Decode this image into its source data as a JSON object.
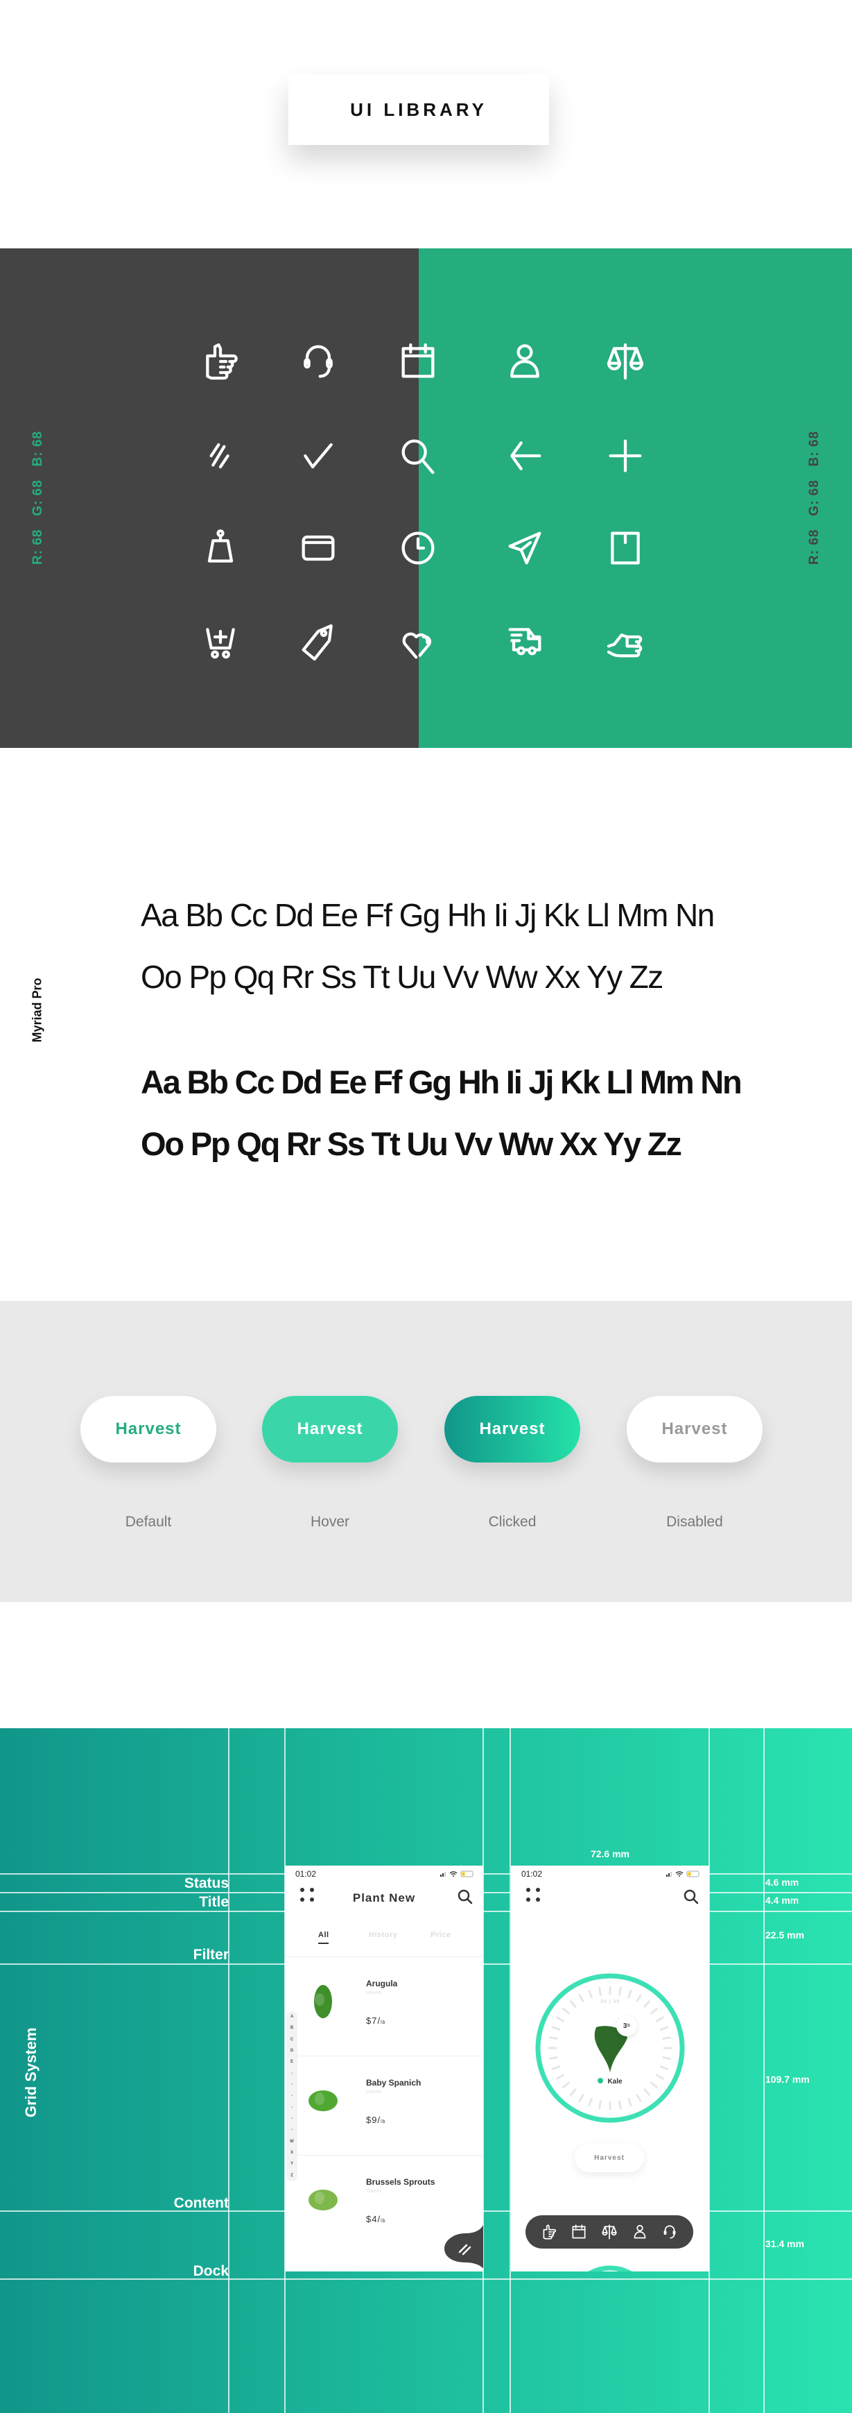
{
  "header": {
    "title": "UI LIBRARY"
  },
  "icons": {
    "colors": {
      "dark": "#444444",
      "green": "#25ad7e"
    },
    "left_label": "R: 68   G: 68   B: 68",
    "right_label": "R: 68   G: 68   B: 68",
    "grid": [
      [
        "hand-icon",
        "headset-icon",
        "calendar-icon",
        "user-icon",
        "scale-icon"
      ],
      [
        "menu-slash-icon",
        "check-icon",
        "search-icon",
        "arrow-left-icon",
        "plus-icon"
      ],
      [
        "weight-icon",
        "card-icon",
        "clock-icon",
        "send-icon",
        "box-icon"
      ],
      [
        "cart-add-icon",
        "tag-icon",
        "hearts-icon",
        "truck-icon",
        "hand-give-icon"
      ]
    ]
  },
  "typography": {
    "font_label": "Myriad Pro",
    "regular": [
      "Aa Bb Cc Dd Ee Ff Gg Hh Ii Jj Kk Ll Mm Nn",
      "Oo Pp Qq Rr Ss Tt Uu Vv Ww Xx Yy Zz"
    ],
    "bold": [
      "Aa Bb Cc Dd Ee Ff Gg Hh Ii Jj Kk Ll Mm Nn",
      "Oo Pp Qq Rr Ss Tt Uu Vv Ww Xx Yy Zz"
    ]
  },
  "buttons": {
    "states": [
      {
        "label": "Harvest",
        "state": "Default"
      },
      {
        "label": "Harvest",
        "state": "Hover"
      },
      {
        "label": "Harvest",
        "state": "Clicked"
      },
      {
        "label": "Harvest",
        "state": "Disabled"
      }
    ],
    "colors": {
      "default_text": "#25ad7e",
      "hover_bg": "#3ad6aa",
      "clicked_from": "#11968a",
      "clicked_to": "#25e2a9",
      "disabled_text": "#999999"
    }
  },
  "grid_system": {
    "title": "Grid System",
    "rows": [
      "Status",
      "Title",
      "Filter",
      "Content",
      "Dock"
    ],
    "measurements": [
      "4.6 mm",
      "4.4 mm",
      "22.5 mm",
      "109.7 mm",
      "31.4 mm"
    ],
    "width_label": "72.6 mm"
  },
  "phone_list": {
    "time": "01:02",
    "title": "Plant New",
    "tabs": [
      "All",
      "History",
      "Price"
    ],
    "active_tab": "All",
    "alphabet": [
      "A",
      "B",
      "C",
      "D",
      "E",
      "-",
      "-",
      "-",
      "-",
      "-",
      "-",
      "W",
      "X",
      "Y",
      "Z"
    ],
    "items": [
      {
        "name": "Arugula",
        "category": "Leaves",
        "price": "$7/",
        "unit": "lb"
      },
      {
        "name": "Baby Spanich",
        "category": "Leaves",
        "price": "$9/",
        "unit": "lb"
      },
      {
        "name": "Brussels Sprouts",
        "category": "Tubers",
        "price": "$4/",
        "unit": "lb"
      }
    ]
  },
  "phone_scale": {
    "time": "01:02",
    "dial_label": "30 | 30",
    "weight": "3",
    "weight_unit": "lb",
    "plant": "Kale",
    "button": "Harvest",
    "dock": [
      "hand-icon",
      "calendar-icon",
      "scale-icon",
      "user-icon",
      "headset-icon"
    ],
    "accent": "#3de0b4"
  }
}
